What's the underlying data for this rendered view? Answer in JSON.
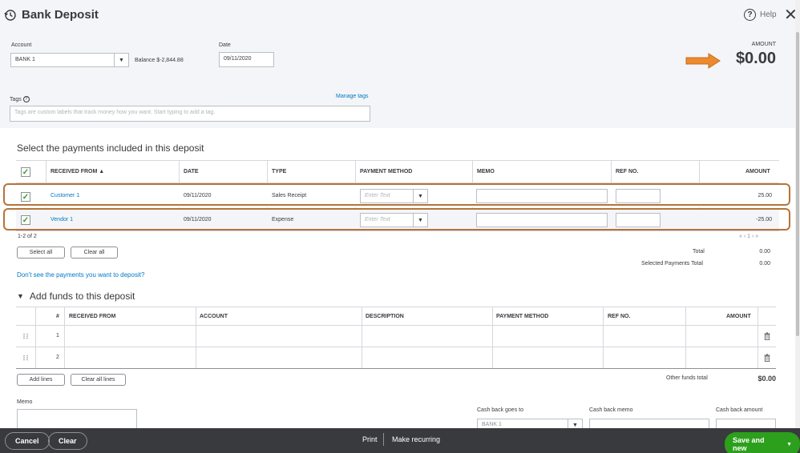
{
  "header": {
    "title": "Bank Deposit",
    "help_label": "Help"
  },
  "account": {
    "label": "Account",
    "value": "BANK 1",
    "balance": "Balance $-2,844.88"
  },
  "date": {
    "label": "Date",
    "value": "09/11/2020"
  },
  "amount": {
    "label": "AMOUNT",
    "value": "$0.00"
  },
  "tags": {
    "label": "Tags",
    "manage_label": "Manage tags",
    "placeholder": "Tags are custom labels that track money how you want. Start typing to add a tag."
  },
  "payments": {
    "heading": "Select the payments included in this deposit",
    "columns": [
      "RECEIVED FROM ▲",
      "DATE",
      "TYPE",
      "PAYMENT METHOD",
      "MEMO",
      "REF NO.",
      "AMOUNT"
    ],
    "rows": [
      {
        "received_from": "Customer 1",
        "date": "09/11/2020",
        "type": "Sales Receipt",
        "payment_method_placeholder": "Enter Text",
        "memo": "",
        "ref_no": "",
        "amount": "25.00"
      },
      {
        "received_from": "Vendor 1",
        "date": "09/11/2020",
        "type": "Expense",
        "payment_method_placeholder": "Enter Text",
        "memo": "",
        "ref_no": "",
        "amount": "-25.00"
      }
    ],
    "count": "1-2 of 2",
    "pagination": "« ‹ 1 › »",
    "select_all": "Select all",
    "clear_all": "Clear all",
    "total_label": "Total",
    "total_value": "0.00",
    "selected_label": "Selected Payments Total",
    "selected_value": "0.00",
    "dont_see_link": "Don't see the payments you want to deposit?"
  },
  "funds": {
    "heading": "Add funds to this deposit",
    "columns": [
      "#",
      "RECEIVED FROM",
      "ACCOUNT",
      "DESCRIPTION",
      "PAYMENT METHOD",
      "REF NO.",
      "AMOUNT"
    ],
    "rows": [
      {
        "num": "1"
      },
      {
        "num": "2"
      }
    ],
    "add_lines": "Add lines",
    "clear_all_lines": "Clear all lines",
    "other_total_label": "Other funds total",
    "other_total_value": "$0.00"
  },
  "memo": {
    "label": "Memo"
  },
  "cashback": {
    "goes_to_label": "Cash back goes to",
    "goes_to_value": "BANK 1",
    "memo_label": "Cash back memo",
    "amount_label": "Cash back amount"
  },
  "footer": {
    "cancel": "Cancel",
    "clear": "Clear",
    "print": "Print",
    "make_recurring": "Make recurring",
    "save_and_new": "Save and new"
  },
  "colors": {
    "accent_green": "#2ca01c",
    "link_blue": "#0077c5",
    "highlight_orange": "#b5743a",
    "arrow_orange": "#ec8a2e",
    "footer_bg": "#393a3d"
  }
}
